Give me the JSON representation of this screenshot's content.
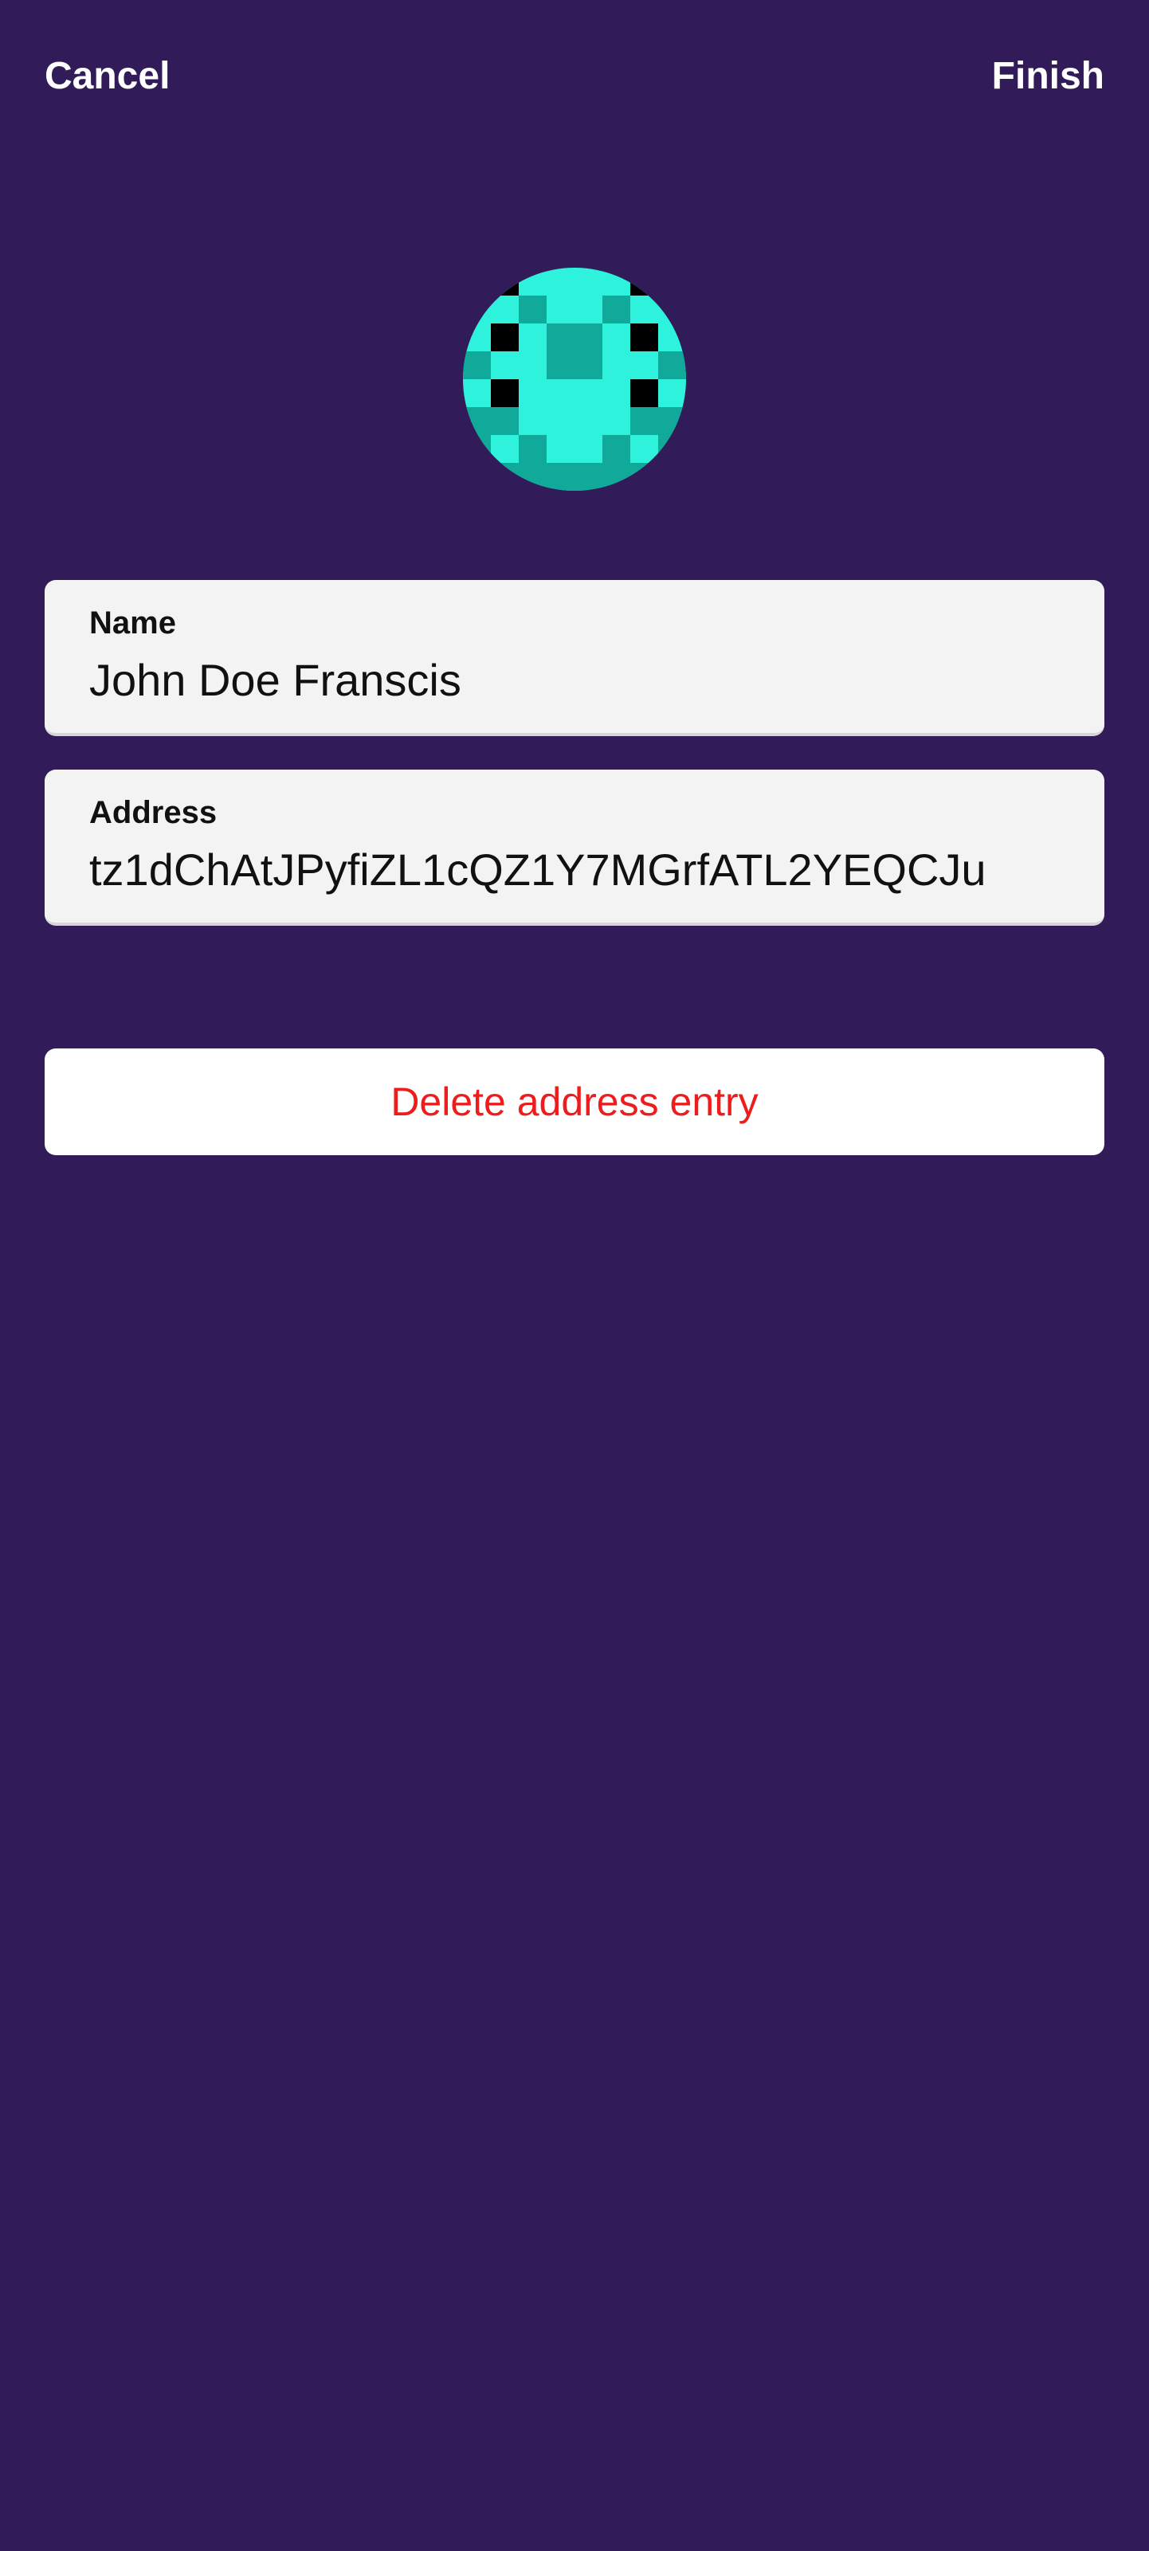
{
  "header": {
    "cancel_label": "Cancel",
    "finish_label": "Finish"
  },
  "avatar": {
    "icon": "identicon-avatar",
    "colors": {
      "light": "#2ef2dc",
      "dark": "#11a99a",
      "black": "#000000"
    }
  },
  "fields": {
    "name": {
      "label": "Name",
      "value": "John Doe Franscis"
    },
    "address": {
      "label": "Address",
      "value": "tz1dChAtJPyfiZL1cQZ1Y7MGrfATL2YEQCJu"
    }
  },
  "actions": {
    "delete_label": "Delete address entry"
  },
  "colors": {
    "background": "#311b58",
    "field_background": "#f3f3f3",
    "danger": "#ee1d1d"
  }
}
